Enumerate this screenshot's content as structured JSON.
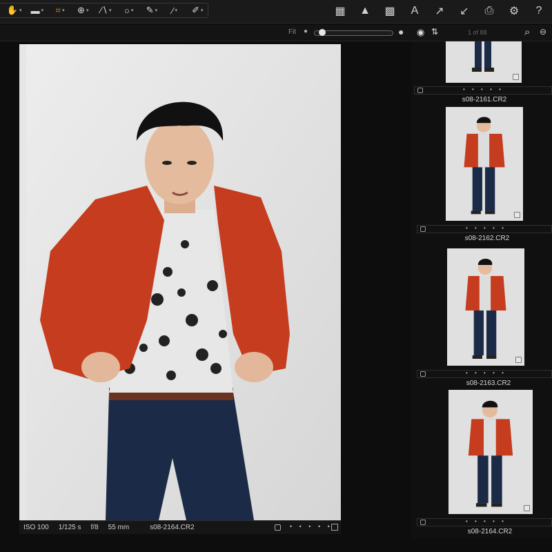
{
  "toolbar": {
    "left_tools": [
      {
        "name": "pan-tool",
        "glyph": "✋"
      },
      {
        "name": "select-tool",
        "glyph": "▬"
      },
      {
        "name": "crop-tool",
        "glyph": "⌗"
      },
      {
        "name": "rotate-tool",
        "glyph": "⊕"
      },
      {
        "name": "keystone-tool",
        "glyph": "∕∖"
      },
      {
        "name": "spot-tool",
        "glyph": "○"
      },
      {
        "name": "brush-tool",
        "glyph": "✎"
      },
      {
        "name": "picker-tool",
        "glyph": "⁄"
      },
      {
        "name": "annotate-tool",
        "glyph": "✐"
      }
    ],
    "active_tool": "crop-tool",
    "accent_color": "#f08a1c",
    "right_tools": [
      {
        "name": "grid-view",
        "glyph": "▦"
      },
      {
        "name": "exposure-warning",
        "glyph": "▲"
      },
      {
        "name": "grid-overlay",
        "glyph": "▩"
      },
      {
        "name": "text-tool",
        "glyph": "A"
      },
      {
        "name": "copy-adjustments",
        "glyph": "↗"
      },
      {
        "name": "apply-adjustments",
        "glyph": "↙"
      },
      {
        "name": "print",
        "glyph": "⎙"
      },
      {
        "name": "settings",
        "glyph": "⚙"
      },
      {
        "name": "help",
        "glyph": "?"
      }
    ]
  },
  "viewer_bar": {
    "fit_label": "Fit",
    "zoom_fraction": 0.06,
    "count_label": "1 of 88"
  },
  "main_image": {
    "filename": "s08-2164.CR2",
    "iso": "ISO 100",
    "shutter": "1/125 s",
    "aperture": "f/8",
    "focal_length": "55 mm",
    "dots": "• • • • •"
  },
  "browser": {
    "thumbnails": [
      {
        "filename": "",
        "dots": "• • • • •",
        "selected": false
      },
      {
        "filename": "s08-2161.CR2",
        "dots": "• • • • •",
        "selected": false
      },
      {
        "filename": "s08-2162.CR2",
        "dots": "• • • • •",
        "selected": false
      },
      {
        "filename": "s08-2163.CR2",
        "dots": "• • • • •",
        "selected": false
      },
      {
        "filename": "s08-2164.CR2",
        "dots": "• • • • •",
        "selected": true
      }
    ]
  }
}
